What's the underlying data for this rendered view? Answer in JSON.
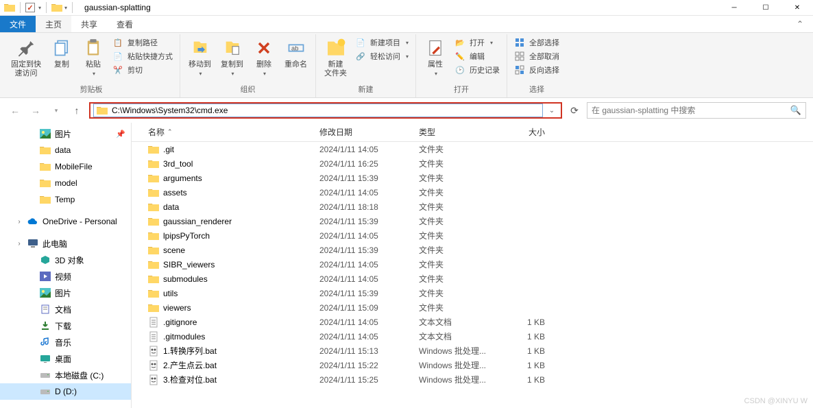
{
  "title": "gaussian-splatting",
  "ribbon_tabs": {
    "file": "文件",
    "home": "主页",
    "share": "共享",
    "view": "查看"
  },
  "ribbon": {
    "clipboard": {
      "pin": "固定到快\n速访问",
      "copy": "复制",
      "paste": "粘贴",
      "copy_path": "复制路径",
      "paste_shortcut": "粘贴快捷方式",
      "cut": "剪切",
      "group": "剪贴板"
    },
    "organize": {
      "move_to": "移动到",
      "copy_to": "复制到",
      "delete": "删除",
      "rename": "重命名",
      "group": "组织"
    },
    "new": {
      "new_folder": "新建\n文件夹",
      "new_item": "新建项目",
      "easy_access": "轻松访问",
      "group": "新建"
    },
    "open": {
      "properties": "属性",
      "open": "打开",
      "edit": "编辑",
      "history": "历史记录",
      "group": "打开"
    },
    "select": {
      "select_all": "全部选择",
      "select_none": "全部取消",
      "invert": "反向选择",
      "group": "选择"
    }
  },
  "address": "C:\\Windows\\System32\\cmd.exe",
  "search_placeholder": "在 gaussian-splatting 中搜索",
  "sidebar": {
    "items": [
      {
        "id": "pictures",
        "label": "图片",
        "icon": "pictures",
        "depth": 2,
        "pinned": true
      },
      {
        "id": "data",
        "label": "data",
        "icon": "folder",
        "depth": 2
      },
      {
        "id": "mobilefile",
        "label": "MobileFile",
        "icon": "folder",
        "depth": 2
      },
      {
        "id": "model",
        "label": "model",
        "icon": "folder",
        "depth": 2
      },
      {
        "id": "temp",
        "label": "Temp",
        "icon": "folder",
        "depth": 2
      },
      {
        "id": "onedrive",
        "label": "OneDrive - Personal",
        "icon": "cloud",
        "depth": 1,
        "blank_before": true
      },
      {
        "id": "thispc",
        "label": "此电脑",
        "icon": "pc",
        "depth": 1,
        "blank_before": true
      },
      {
        "id": "3dobj",
        "label": "3D 对象",
        "icon": "3d",
        "depth": 2
      },
      {
        "id": "videos",
        "label": "视频",
        "icon": "video",
        "depth": 2
      },
      {
        "id": "pics2",
        "label": "图片",
        "icon": "pictures",
        "depth": 2
      },
      {
        "id": "docs",
        "label": "文档",
        "icon": "docs",
        "depth": 2
      },
      {
        "id": "downloads",
        "label": "下载",
        "icon": "download",
        "depth": 2
      },
      {
        "id": "music",
        "label": "音乐",
        "icon": "music",
        "depth": 2
      },
      {
        "id": "desktop",
        "label": "桌面",
        "icon": "desktop",
        "depth": 2
      },
      {
        "id": "cdisk",
        "label": "本地磁盘 (C:)",
        "icon": "disk",
        "depth": 2
      },
      {
        "id": "ddisk",
        "label": "D (D:)",
        "icon": "disk",
        "depth": 2,
        "selected": true
      }
    ]
  },
  "columns": {
    "name": "名称",
    "date": "修改日期",
    "type": "类型",
    "size": "大小"
  },
  "files": [
    {
      "name": ".git",
      "date": "2024/1/11 14:05",
      "type": "文件夹",
      "size": "",
      "icon": "folder"
    },
    {
      "name": "3rd_tool",
      "date": "2024/1/11 16:25",
      "type": "文件夹",
      "size": "",
      "icon": "folder"
    },
    {
      "name": "arguments",
      "date": "2024/1/11 15:39",
      "type": "文件夹",
      "size": "",
      "icon": "folder"
    },
    {
      "name": "assets",
      "date": "2024/1/11 14:05",
      "type": "文件夹",
      "size": "",
      "icon": "folder"
    },
    {
      "name": "data",
      "date": "2024/1/11 18:18",
      "type": "文件夹",
      "size": "",
      "icon": "folder"
    },
    {
      "name": "gaussian_renderer",
      "date": "2024/1/11 15:39",
      "type": "文件夹",
      "size": "",
      "icon": "folder"
    },
    {
      "name": "lpipsPyTorch",
      "date": "2024/1/11 14:05",
      "type": "文件夹",
      "size": "",
      "icon": "folder"
    },
    {
      "name": "scene",
      "date": "2024/1/11 15:39",
      "type": "文件夹",
      "size": "",
      "icon": "folder"
    },
    {
      "name": "SIBR_viewers",
      "date": "2024/1/11 14:05",
      "type": "文件夹",
      "size": "",
      "icon": "folder"
    },
    {
      "name": "submodules",
      "date": "2024/1/11 14:05",
      "type": "文件夹",
      "size": "",
      "icon": "folder"
    },
    {
      "name": "utils",
      "date": "2024/1/11 15:39",
      "type": "文件夹",
      "size": "",
      "icon": "folder"
    },
    {
      "name": "viewers",
      "date": "2024/1/11 15:09",
      "type": "文件夹",
      "size": "",
      "icon": "folder"
    },
    {
      "name": ".gitignore",
      "date": "2024/1/11 14:05",
      "type": "文本文档",
      "size": "1 KB",
      "icon": "text"
    },
    {
      "name": ".gitmodules",
      "date": "2024/1/11 14:05",
      "type": "文本文档",
      "size": "1 KB",
      "icon": "text"
    },
    {
      "name": "1.转换序列.bat",
      "date": "2024/1/11 15:13",
      "type": "Windows 批处理...",
      "size": "1 KB",
      "icon": "bat"
    },
    {
      "name": "2.产生点云.bat",
      "date": "2024/1/11 15:22",
      "type": "Windows 批处理...",
      "size": "1 KB",
      "icon": "bat"
    },
    {
      "name": "3.检查对位.bat",
      "date": "2024/1/11 15:25",
      "type": "Windows 批处理...",
      "size": "1 KB",
      "icon": "bat"
    }
  ],
  "watermark": "CSDN @XINYU W"
}
